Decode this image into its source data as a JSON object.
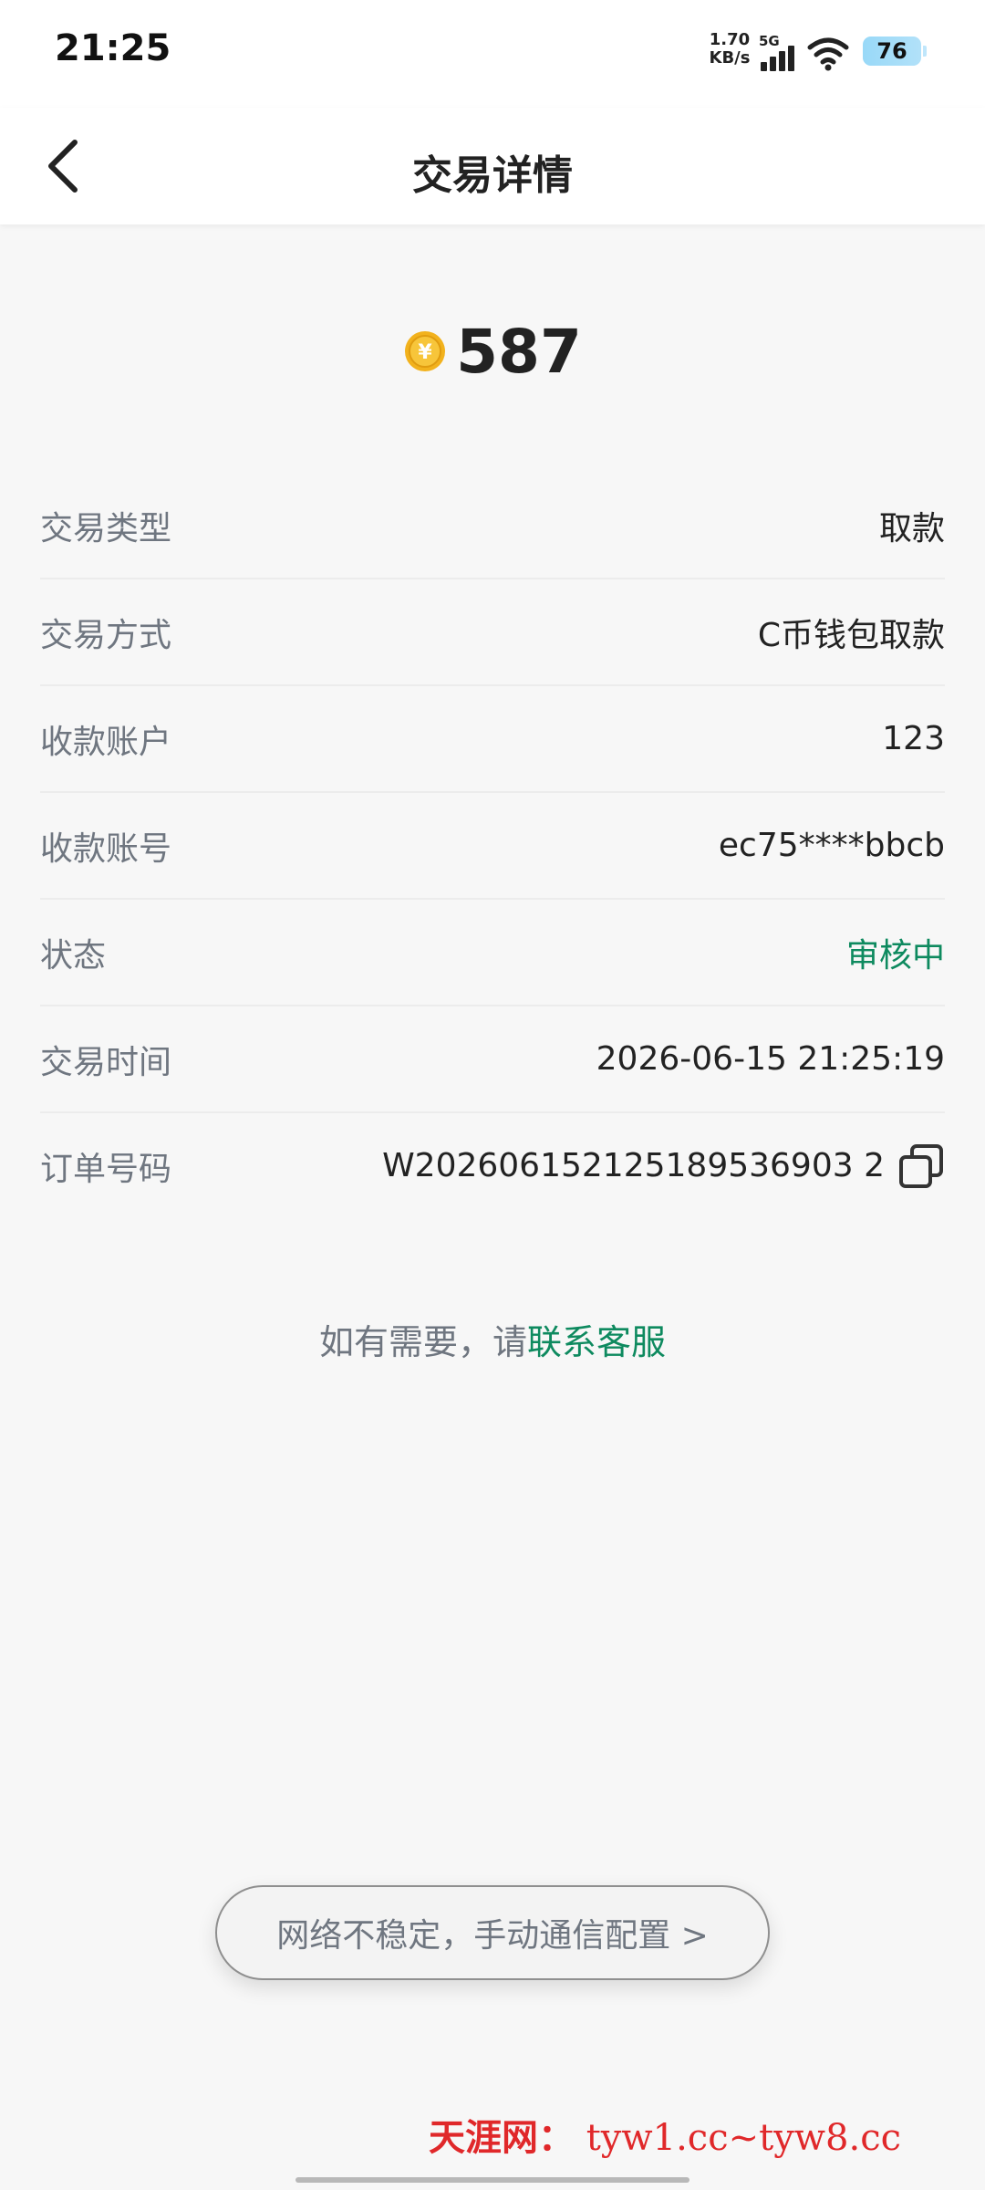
{
  "status_bar": {
    "time": "21:25",
    "net_speed_value": "1.70",
    "net_speed_unit": "KB/s",
    "network_type": "5G",
    "battery": "76"
  },
  "header": {
    "title": "交易详情"
  },
  "amount": {
    "value": "587",
    "coin_symbol": "¥"
  },
  "details": [
    {
      "label": "交易类型",
      "value": "取款"
    },
    {
      "label": "交易方式",
      "value": "C币钱包取款"
    },
    {
      "label": "收款账户",
      "value": "123"
    },
    {
      "label": "收款账号",
      "value": "ec75****bbcb"
    },
    {
      "label": "状态",
      "value": "审核中"
    },
    {
      "label": "交易时间",
      "value": "2026-06-15 21:25:19"
    },
    {
      "label": "订单号码",
      "value": "W202606152125189536903 2"
    }
  ],
  "help": {
    "prefix": "如有需要，请",
    "link": "联系客服"
  },
  "network_notice": {
    "label": "网络不稳定，手动通信配置 >"
  },
  "watermark": {
    "cn": "天涯网：",
    "en": "tyw1.cc~tyw8.cc"
  },
  "colors": {
    "accent_green": "#0e8a5f",
    "watermark_red": "#e0282a",
    "coin_gold": "#f2b21d"
  }
}
